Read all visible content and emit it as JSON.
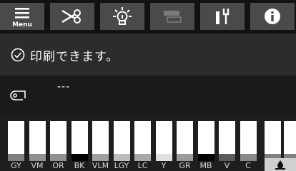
{
  "toolbar": {
    "menu_label": "Menu",
    "buttons": [
      "menu-icon",
      "scissors-icon",
      "lamp-icon",
      "layout-icon",
      "tools-icon",
      "info-icon"
    ]
  },
  "status": {
    "icon": "check-circle-icon",
    "message": "印刷できます。"
  },
  "paper": {
    "icon": "paper-roll-icon",
    "value": "---"
  },
  "ink": {
    "cartridges": [
      {
        "label": "GY",
        "level": 0.17,
        "level_color": "#808080"
      },
      {
        "label": "VM",
        "level": 0.17,
        "level_color": "#909090"
      },
      {
        "label": "OR",
        "level": 0.17,
        "level_color": "#909090"
      },
      {
        "label": "BK",
        "level": 0.17,
        "level_color": "#000000"
      },
      {
        "label": "VLM",
        "level": 0.17,
        "level_color": "#a0a0a0"
      },
      {
        "label": "LGY",
        "level": 0.17,
        "level_color": "#bdbdbd"
      },
      {
        "label": "LC",
        "level": 0.17,
        "level_color": "#a8a8a8"
      },
      {
        "label": "Y",
        "level": 0.17,
        "level_color": "#e0e0e0"
      },
      {
        "label": "GR",
        "level": 0.17,
        "level_color": "#9a9a9a"
      },
      {
        "label": "MB",
        "level": 0.17,
        "level_color": "#000000"
      },
      {
        "label": "V",
        "level": 0.17,
        "level_color": "#5a5a5a"
      },
      {
        "label": "C",
        "level": 0.17,
        "level_color": "#8a8a8a"
      }
    ],
    "maintenance_box": {
      "icon": "ink-drop-icon",
      "level": 0.17
    }
  }
}
